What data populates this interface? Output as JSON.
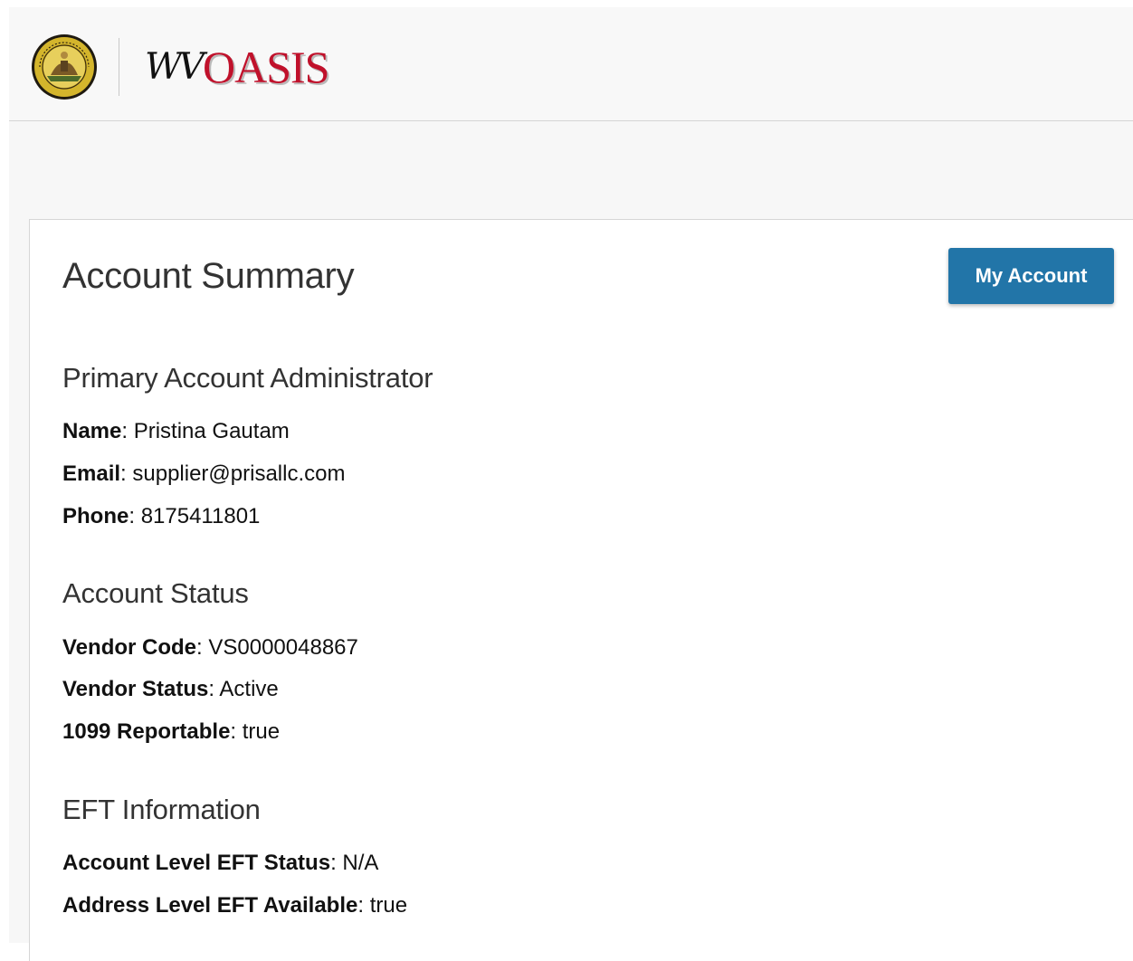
{
  "header": {
    "logo_script": "WV",
    "logo_block": "OASIS",
    "seal_text": "STATE OF WEST VIRGINIA"
  },
  "main": {
    "title": "Account Summary",
    "my_account_label": "My Account",
    "sections": {
      "admin": {
        "title": "Primary Account Administrator",
        "fields": [
          {
            "label": "Name",
            "value": "Pristina Gautam"
          },
          {
            "label": "Email",
            "value": "supplier@prisallc.com"
          },
          {
            "label": "Phone",
            "value": "8175411801"
          }
        ]
      },
      "status": {
        "title": "Account Status",
        "fields": [
          {
            "label": "Vendor Code",
            "value": "VS0000048867"
          },
          {
            "label": "Vendor Status",
            "value": "Active"
          },
          {
            "label": "1099 Reportable",
            "value": "true"
          }
        ]
      },
      "eft": {
        "title": "EFT Information",
        "fields": [
          {
            "label": "Account Level EFT Status",
            "value": "N/A"
          },
          {
            "label": "Address Level EFT Available",
            "value": "true"
          }
        ]
      }
    }
  },
  "colors": {
    "button": "#2275a8",
    "logo_red": "#c0112b",
    "seal_gold": "#d4b52c",
    "seal_ring": "#1f1a10"
  }
}
